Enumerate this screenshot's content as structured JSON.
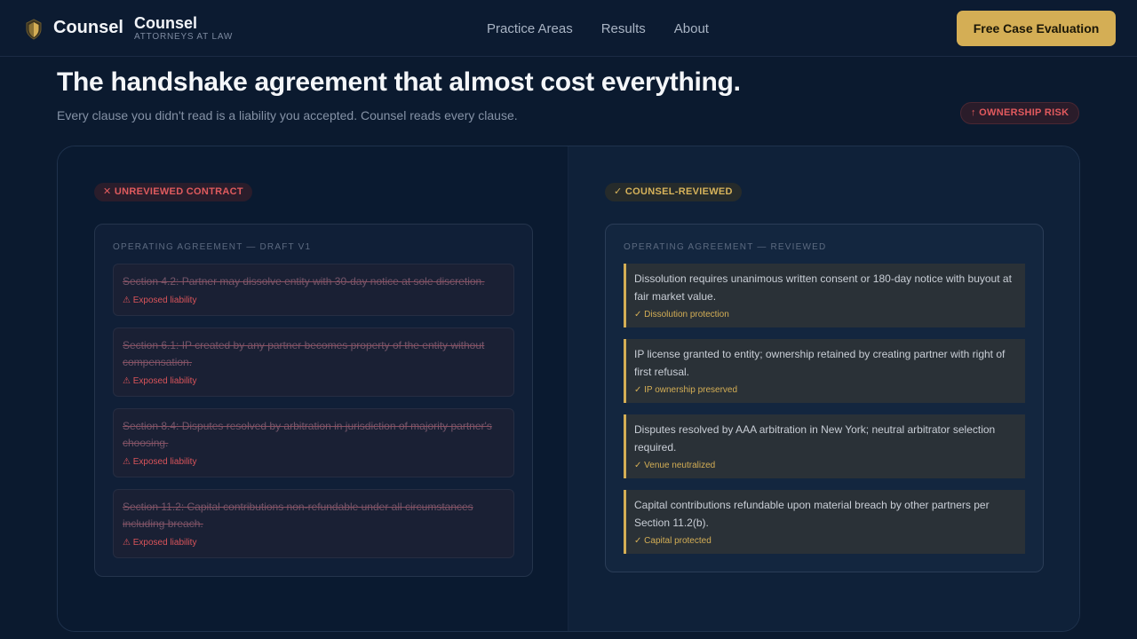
{
  "nav": {
    "brand": "Counsel",
    "brand_title": "Counsel",
    "brand_subtitle": "ATTORNEYS AT LAW",
    "links": [
      "Practice Areas",
      "Results",
      "About"
    ],
    "cta_label": "Free Case Evaluation"
  },
  "hero": {
    "title": "The handshake agreement that almost cost everything.",
    "subtitle": "Every clause you didn't read is a liability you accepted. Counsel reads every clause.",
    "risk_badge": "↑ OWNERSHIP RISK"
  },
  "unreviewed": {
    "badge": "✕ UNREVIEWED CONTRACT",
    "doc_label": "OPERATING AGREEMENT — DRAFT V1",
    "clauses": [
      {
        "text": "Section 4.2: Partner may dissolve entity with 30-day notice at sole discretion.",
        "flag": "⚠ Exposed liability"
      },
      {
        "text": "Section 6.1: IP created by any partner becomes property of the entity without compensation.",
        "flag": "⚠ Exposed liability"
      },
      {
        "text": "Section 8.4: Disputes resolved by arbitration in jurisdiction of majority partner's choosing.",
        "flag": "⚠ Exposed liability"
      },
      {
        "text": "Section 11.2: Capital contributions non-refundable under all circumstances including breach.",
        "flag": "⚠ Exposed liability"
      }
    ]
  },
  "reviewed": {
    "badge": "✓ COUNSEL-REVIEWED",
    "doc_label": "OPERATING AGREEMENT — REVIEWED",
    "clauses": [
      {
        "text": "Dissolution requires unanimous written consent or 180-day notice with buyout at fair market value.",
        "flag": "✓ Dissolution protection"
      },
      {
        "text": "IP license granted to entity; ownership retained by creating partner with right of first refusal.",
        "flag": "✓ IP ownership preserved"
      },
      {
        "text": "Disputes resolved by AAA arbitration in New York; neutral arbitrator selection required.",
        "flag": "✓ Venue neutralized"
      },
      {
        "text": "Capital contributions refundable upon material breach by other partners per Section 11.2(b).",
        "flag": "✓ Capital protected"
      }
    ]
  },
  "colors": {
    "accent": "#d4ae55",
    "danger": "#e05b5e",
    "background": "#0b1a2f"
  }
}
